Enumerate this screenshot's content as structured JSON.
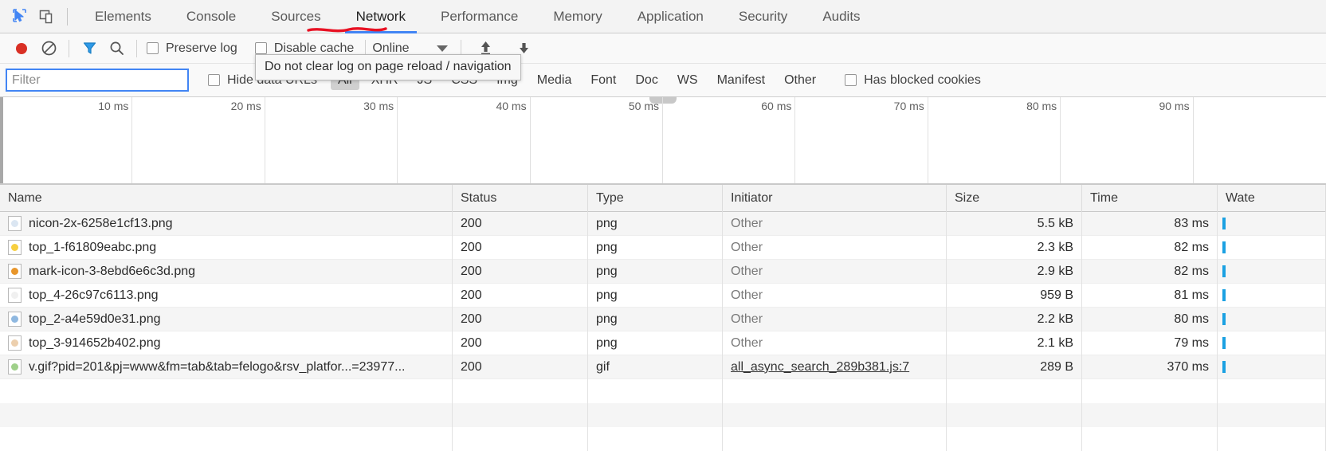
{
  "tabs": {
    "inspect_icon": "inspect-cursor-icon",
    "device_icon": "device-toolbar-icon",
    "items": [
      {
        "label": "Elements",
        "active": false
      },
      {
        "label": "Console",
        "active": false
      },
      {
        "label": "Sources",
        "active": false
      },
      {
        "label": "Network",
        "active": true
      },
      {
        "label": "Performance",
        "active": false
      },
      {
        "label": "Memory",
        "active": false
      },
      {
        "label": "Application",
        "active": false
      },
      {
        "label": "Security",
        "active": false
      },
      {
        "label": "Audits",
        "active": false
      }
    ]
  },
  "toolbar": {
    "record_icon": "record-circle-icon",
    "clear_icon": "clear-prohibited-icon",
    "filter_icon": "filter-funnel-icon",
    "search_icon": "search-magnifier-icon",
    "preserve_log_label": "Preserve log",
    "disable_cache_label": "Disable cache",
    "throttle_value": "Online",
    "import_icon": "import-arrow-up-icon",
    "export_icon": "export-arrow-down-icon"
  },
  "filterbar": {
    "filter_placeholder": "Filter",
    "filter_value": "",
    "hide_data_urls_label": "Hide data URLs",
    "types": [
      {
        "label": "All",
        "active": true
      },
      {
        "label": "XHR",
        "active": false
      },
      {
        "label": "JS",
        "active": false
      },
      {
        "label": "CSS",
        "active": false
      },
      {
        "label": "Img",
        "active": false
      },
      {
        "label": "Media",
        "active": false
      },
      {
        "label": "Font",
        "active": false
      },
      {
        "label": "Doc",
        "active": false
      },
      {
        "label": "WS",
        "active": false
      },
      {
        "label": "Manifest",
        "active": false
      },
      {
        "label": "Other",
        "active": false
      }
    ],
    "has_blocked_cookies_label": "Has blocked cookies"
  },
  "tooltip": {
    "text": "Do not clear log on page reload / navigation"
  },
  "overview": {
    "ticks": [
      "10 ms",
      "20 ms",
      "30 ms",
      "40 ms",
      "50 ms",
      "60 ms",
      "70 ms",
      "80 ms",
      "90 ms"
    ]
  },
  "table": {
    "columns": [
      "Name",
      "Status",
      "Type",
      "Initiator",
      "Size",
      "Time",
      "Wate"
    ],
    "rows": [
      {
        "name": "nicon-2x-6258e1cf13.png",
        "status": "200",
        "type": "png",
        "initiator": "Other",
        "initiator_link": false,
        "size": "5.5 kB",
        "time": "83 ms",
        "thumb_color": "#dbe6f2"
      },
      {
        "name": "top_1-f61809eabc.png",
        "status": "200",
        "type": "png",
        "initiator": "Other",
        "initiator_link": false,
        "size": "2.3 kB",
        "time": "82 ms",
        "thumb_color": "#f7cf3f"
      },
      {
        "name": "mark-icon-3-8ebd6e6c3d.png",
        "status": "200",
        "type": "png",
        "initiator": "Other",
        "initiator_link": false,
        "size": "2.9 kB",
        "time": "82 ms",
        "thumb_color": "#e8962b"
      },
      {
        "name": "top_4-26c97c6113.png",
        "status": "200",
        "type": "png",
        "initiator": "Other",
        "initiator_link": false,
        "size": "959 B",
        "time": "81 ms",
        "thumb_color": "#f0f0f0"
      },
      {
        "name": "top_2-a4e59d0e31.png",
        "status": "200",
        "type": "png",
        "initiator": "Other",
        "initiator_link": false,
        "size": "2.2 kB",
        "time": "80 ms",
        "thumb_color": "#8fb8e0"
      },
      {
        "name": "top_3-914652b402.png",
        "status": "200",
        "type": "png",
        "initiator": "Other",
        "initiator_link": false,
        "size": "2.1 kB",
        "time": "79 ms",
        "thumb_color": "#eccfad"
      },
      {
        "name": "v.gif?pid=201&pj=www&fm=tab&tab=felogo&rsv_platfor...=23977...",
        "status": "200",
        "type": "gif",
        "initiator": "all_async_search_289b381.js:7",
        "initiator_link": true,
        "size": "289 B",
        "time": "370 ms",
        "thumb_color": "#9fd08a"
      }
    ]
  },
  "colors": {
    "accent": "#4285f4",
    "waterfall_bar": "#1ba1e2",
    "record": "#d93025",
    "annotation": "#e81123"
  }
}
